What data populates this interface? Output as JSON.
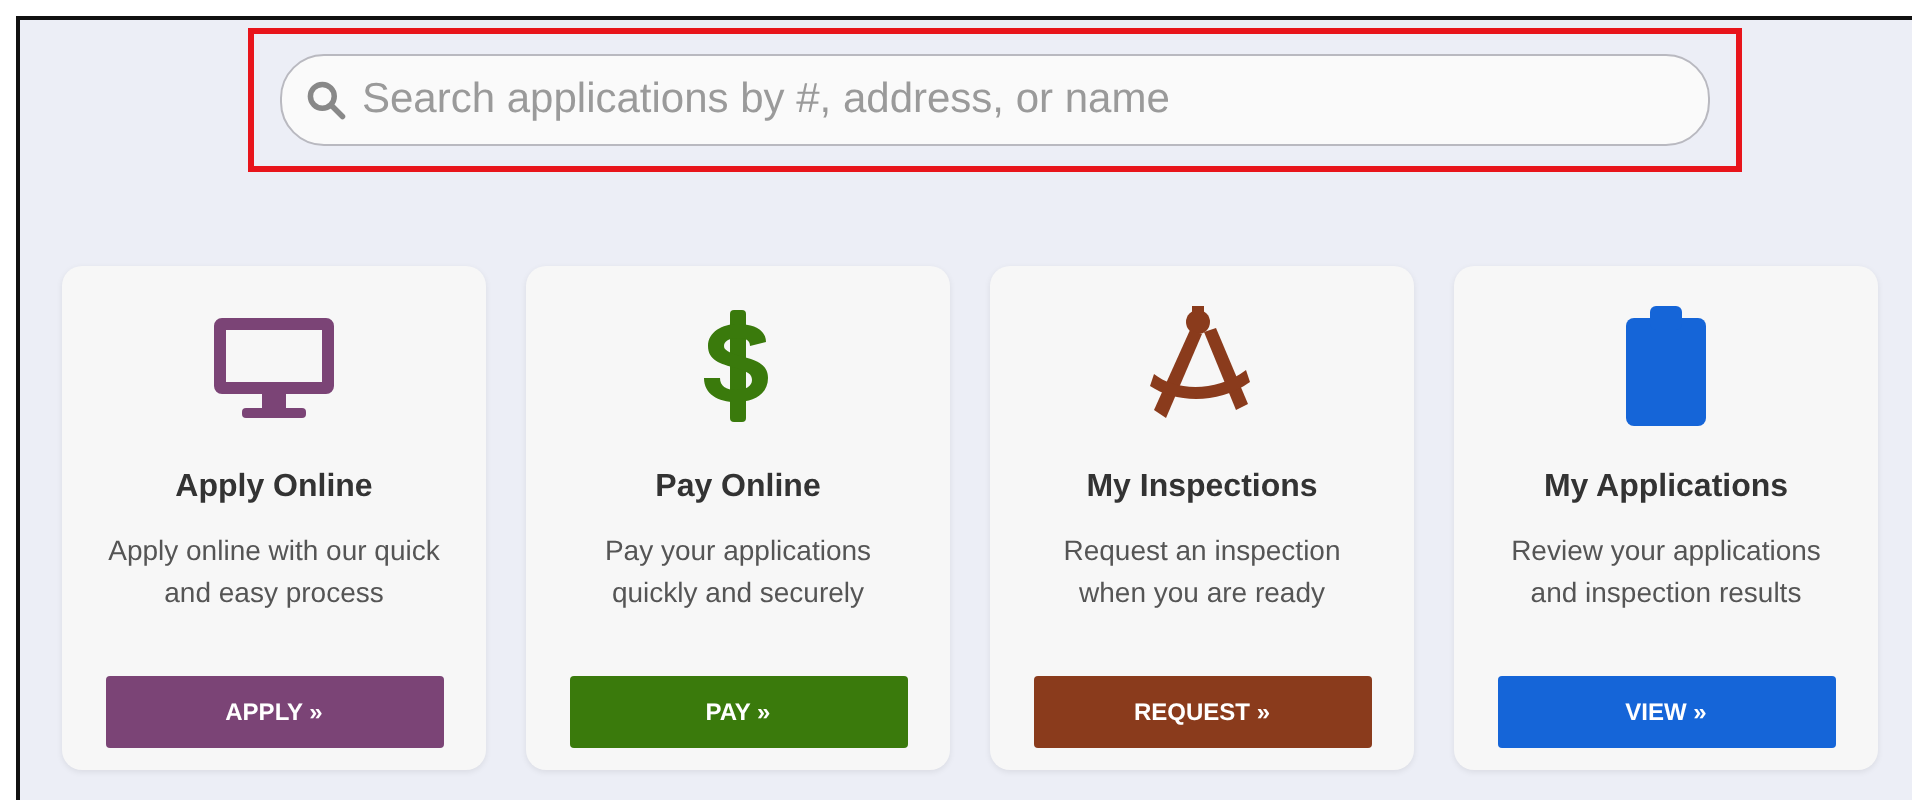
{
  "search": {
    "placeholder": "Search applications by #, address, or name",
    "highlighted": true
  },
  "cards": [
    {
      "kind": "apply",
      "title": "Apply Online",
      "description": "Apply online with our quick and easy process",
      "button": "APPLY »",
      "color": "#7b4476"
    },
    {
      "kind": "pay",
      "title": "Pay Online",
      "description": "Pay your applications quickly and securely",
      "button": "PAY »",
      "color": "#3a7a0c"
    },
    {
      "kind": "inspect",
      "title": "My Inspections",
      "description": "Request an inspection when you are ready",
      "button": "REQUEST »",
      "color": "#8a3b1c"
    },
    {
      "kind": "review",
      "title": "My Applications",
      "description": "Review your applications and inspection results",
      "button": "VIEW »",
      "color": "#1565d8"
    }
  ]
}
